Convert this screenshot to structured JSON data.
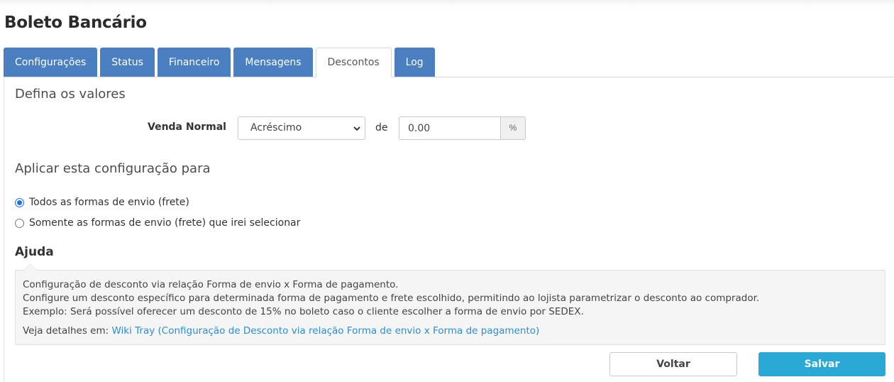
{
  "page": {
    "title": "Boleto Bancário"
  },
  "tabs": [
    {
      "label": "Configurações",
      "active": false
    },
    {
      "label": "Status",
      "active": false
    },
    {
      "label": "Financeiro",
      "active": false
    },
    {
      "label": "Mensagens",
      "active": false
    },
    {
      "label": "Descontos",
      "active": true
    },
    {
      "label": "Log",
      "active": false
    }
  ],
  "values_section": {
    "title": "Defina os valores",
    "row_label": "Venda Normal",
    "select_value": "Acréscimo",
    "connector": "de",
    "amount_value": "0.00",
    "amount_addon": "%"
  },
  "apply_section": {
    "title": "Aplicar esta configuração para",
    "options": [
      {
        "label": "Todos as formas de envio (frete)",
        "checked": true
      },
      {
        "label": "Somente as formas de envio (frete) que irei selecionar",
        "checked": false
      }
    ]
  },
  "help": {
    "title": "Ajuda",
    "lines": [
      "Configuração de desconto via relação Forma de envio x Forma de pagamento.",
      "Configure um desconto específico para determinada forma de pagamento e frete escolhido, permitindo ao lojista parametrizar o desconto ao comprador.",
      "Exemplo: Será possível oferecer um desconto de 15% no boleto caso o cliente escolher a forma de envio por SEDEX."
    ],
    "details_prefix": "Veja detalhes em: ",
    "details_link": "Wiki Tray (Configuração de Desconto via relação Forma de envio x Forma de pagamento)"
  },
  "buttons": {
    "back": "Voltar",
    "save": "Salvar"
  },
  "colors": {
    "tab": "#4a7fc1",
    "save": "#29a9d6",
    "link": "#2a8fd0",
    "radio_checked": "#1a73e8"
  }
}
